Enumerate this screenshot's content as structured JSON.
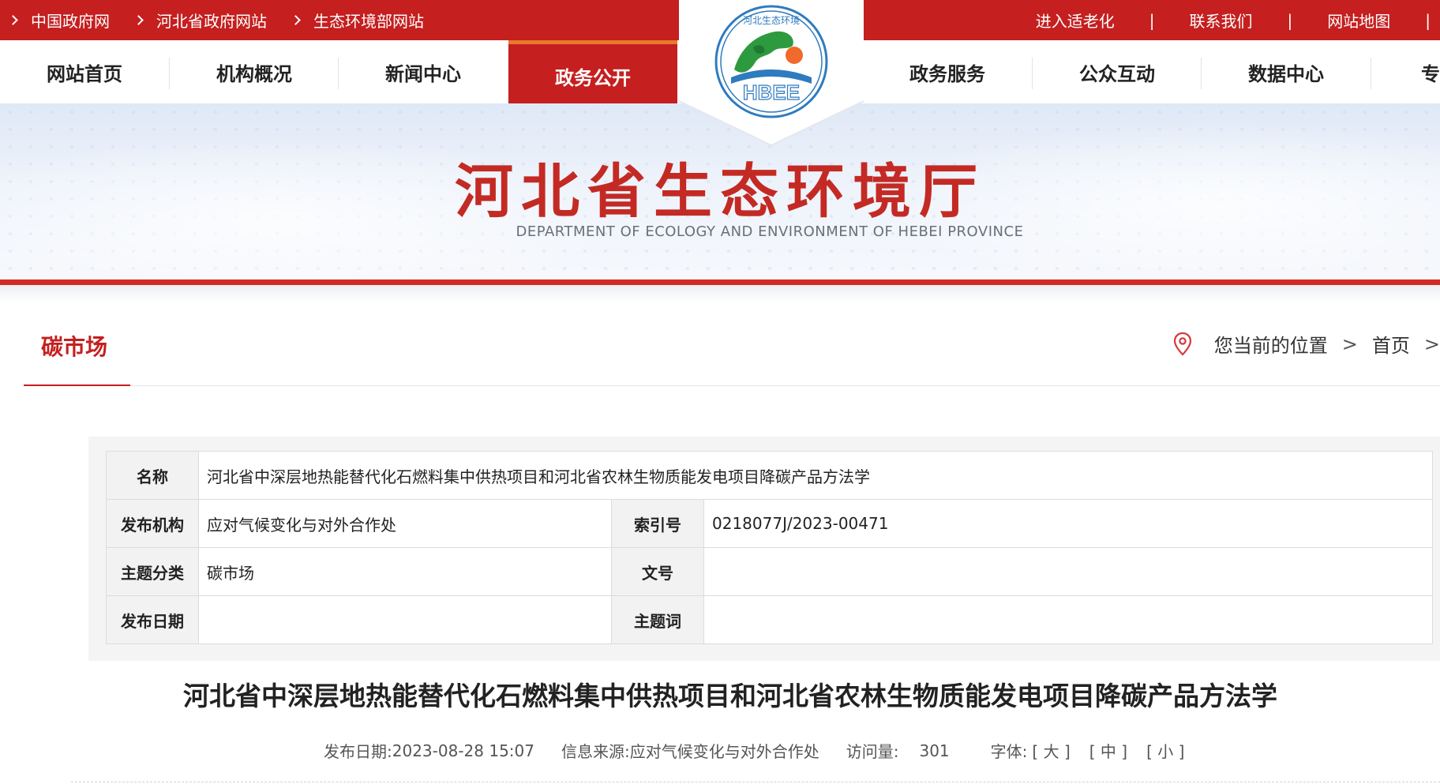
{
  "topbar": {
    "links": [
      "中国政府网",
      "河北省政府网站",
      "生态环境部网站"
    ],
    "right_links": [
      "进入适老化",
      "联系我们",
      "网站地图"
    ]
  },
  "nav": {
    "items": [
      "网站首页",
      "机构概况",
      "新闻中心",
      "政务公开",
      "政务服务",
      "公众互动",
      "数据中心",
      "专"
    ],
    "active": "政务公开"
  },
  "logo": {
    "ring_text": "河北生态环境",
    "abbr": "HBEE"
  },
  "banner": {
    "title": "河北省生态环境厅",
    "subtitle": "DEPARTMENT OF ECOLOGY AND ENVIRONMENT OF HEBEI PROVINCE"
  },
  "section": {
    "title": "碳市场"
  },
  "location": {
    "label": "您当前的位置",
    "sep": ">",
    "home": "首页",
    "sep2": ">"
  },
  "info": {
    "name_label": "名称",
    "name_value": "河北省中深层地热能替代化石燃料集中供热项目和河北省农林生物质能发电项目降碳产品方法学",
    "org_label": "发布机构",
    "org_value": "应对气候变化与对外合作处",
    "index_label": "索引号",
    "index_value": "0218077J/2023-00471",
    "topic_label": "主题分类",
    "topic_value": "碳市场",
    "docno_label": "文号",
    "docno_value": "",
    "date_label": "发布日期",
    "date_value": "",
    "keywords_label": "主题词",
    "keywords_value": ""
  },
  "article": {
    "title": "河北省中深层地热能替代化石燃料集中供热项目和河北省农林生物质能发电项目降碳产品方法学",
    "date_label": "发布日期:",
    "date": "2023-08-28 15:07",
    "source_label": "信息来源:",
    "source": "应对气候变化与对外合作处",
    "views_label": "访问量:",
    "views": "301",
    "font_label": "字体:",
    "font_large": "[ 大 ]",
    "font_medium": "[ 中 ]",
    "font_small": "[ 小 ]"
  }
}
